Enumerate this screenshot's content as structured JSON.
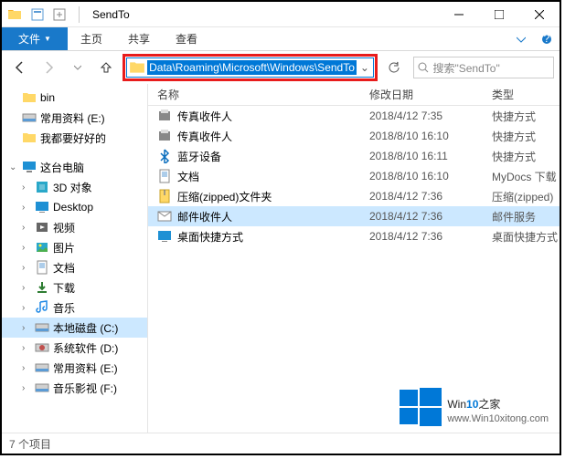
{
  "title": "SendTo",
  "ribbon": {
    "file": "文件",
    "home": "主页",
    "share": "共享",
    "view": "查看"
  },
  "address_path": "Data\\Roaming\\Microsoft\\Windows\\SendTo",
  "search_placeholder": "搜索\"SendTo\"",
  "sidebar": {
    "quick": [
      {
        "label": "bin",
        "icon": "folder"
      },
      {
        "label": "常用资料 (E:)",
        "icon": "drive"
      },
      {
        "label": "我都要好好的",
        "icon": "folder"
      }
    ],
    "thispc_label": "这台电脑",
    "thispc": [
      {
        "label": "3D 对象",
        "icon": "3d"
      },
      {
        "label": "Desktop",
        "icon": "desktop"
      },
      {
        "label": "视频",
        "icon": "video"
      },
      {
        "label": "图片",
        "icon": "pictures"
      },
      {
        "label": "文档",
        "icon": "docs"
      },
      {
        "label": "下载",
        "icon": "downloads"
      },
      {
        "label": "音乐",
        "icon": "music"
      },
      {
        "label": "本地磁盘 (C:)",
        "icon": "drive",
        "selected": true
      },
      {
        "label": "系统软件 (D:)",
        "icon": "drive-d"
      },
      {
        "label": "常用资料 (E:)",
        "icon": "drive"
      },
      {
        "label": "音乐影视 (F:)",
        "icon": "drive"
      }
    ]
  },
  "columns": {
    "name": "名称",
    "date": "修改日期",
    "type": "类型"
  },
  "files": [
    {
      "name": "传真收件人",
      "date": "2018/4/12 7:35",
      "type": "快捷方式",
      "icon": "fax"
    },
    {
      "name": "传真收件人",
      "date": "2018/8/10 16:10",
      "type": "快捷方式",
      "icon": "fax"
    },
    {
      "name": "蓝牙设备",
      "date": "2018/8/10 16:11",
      "type": "快捷方式",
      "icon": "bluetooth"
    },
    {
      "name": "文档",
      "date": "2018/8/10 16:10",
      "type": "MyDocs 下载",
      "icon": "docs"
    },
    {
      "name": "压缩(zipped)文件夹",
      "date": "2018/4/12 7:36",
      "type": "压缩(zipped)",
      "icon": "zip"
    },
    {
      "name": "邮件收件人",
      "date": "2018/4/12 7:36",
      "type": "邮件服务",
      "icon": "mail",
      "selected": true
    },
    {
      "name": "桌面快捷方式",
      "date": "2018/4/12 7:36",
      "type": "桌面快捷方式",
      "icon": "desktop"
    }
  ],
  "status_text": "7 个项目",
  "watermark": {
    "brand_a": "Win",
    "brand_b": "10",
    "brand_c": "之家",
    "url": "www.Win10xitong.com"
  }
}
